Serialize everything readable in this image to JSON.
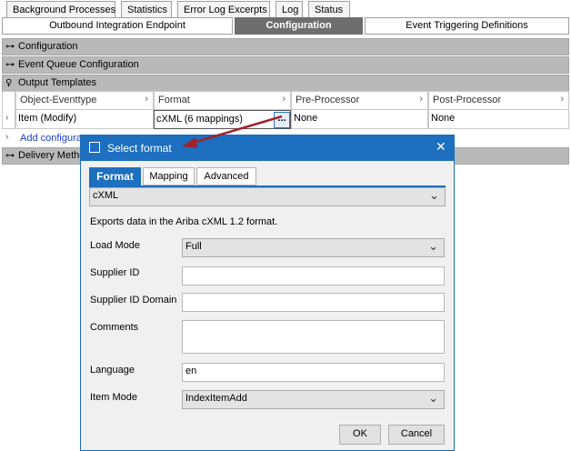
{
  "top_tabs": [
    "Background Processes",
    "Statistics",
    "Error Log Excerpts",
    "Log",
    "Status"
  ],
  "sub_tabs": {
    "outbound": "Outbound Integration Endpoint",
    "configuration": "Configuration",
    "event_triggering": "Event Triggering Definitions"
  },
  "sections": {
    "configuration": "Configuration",
    "event_queue": "Event Queue Configuration",
    "output_templates": "Output Templates",
    "delivery": "Delivery Metho"
  },
  "grid": {
    "columns": [
      "Object-Eventtype",
      "Format",
      "Pre-Processor",
      "Post-Processor"
    ],
    "row": {
      "object": "Item (Modify)",
      "format": "cXML (6 mappings)",
      "ellipsis": "...",
      "pre": "None",
      "post": "None"
    },
    "add_link": "Add configura"
  },
  "dialog": {
    "title": "Select format",
    "close": "✕",
    "tabs": [
      "Format",
      "Mapping",
      "Advanced"
    ],
    "format_value": "cXML",
    "description": "Exports data in the Ariba cXML 1.2 format.",
    "fields": {
      "load_mode": {
        "label": "Load Mode",
        "value": "Full"
      },
      "supplier_id": {
        "label": "Supplier ID",
        "value": ""
      },
      "supplier_id_domain": {
        "label": "Supplier ID Domain",
        "value": ""
      },
      "comments": {
        "label": "Comments",
        "value": ""
      },
      "language": {
        "label": "Language",
        "value": "en"
      },
      "item_mode": {
        "label": "Item Mode",
        "value": "IndexItemAdd"
      }
    },
    "ok": "OK",
    "cancel": "Cancel"
  },
  "colors": {
    "dialog_title_bg": "#1d6fbf",
    "active_tab_bg": "#1d6fbf",
    "section_bg": "#b9b9b9",
    "arrow": "#a0222a",
    "link": "#1a3fd0"
  }
}
